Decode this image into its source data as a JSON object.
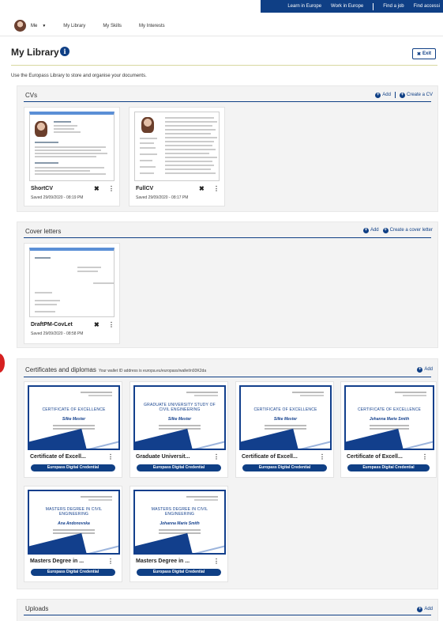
{
  "topbar": {
    "links": [
      "Learn in Europe",
      "Work in Europe",
      "Find a job",
      "Find accessi"
    ]
  },
  "subnav": {
    "me_label": "Me",
    "links": [
      "My Library",
      "My Skills",
      "My Interests"
    ]
  },
  "header": {
    "title": "My Library",
    "exit_label": "Exit"
  },
  "intro": "Use the Europass Library to store and organise your documents.",
  "cvs": {
    "title": "CVs",
    "add_label": "Add",
    "create_label": "Create a CV",
    "items": [
      {
        "name": "ShortCV",
        "saved": "Saved 29/09/2020 - 08:19 PM"
      },
      {
        "name": "FullCV",
        "saved": "Saved 29/09/2020 - 08:17 PM"
      }
    ]
  },
  "cover_letters": {
    "title": "Cover letters",
    "add_label": "Add",
    "create_label": "Create a cover letter",
    "items": [
      {
        "name": "DraftPM-CovLet",
        "saved": "Saved 29/09/2020 - 08:58 PM"
      }
    ]
  },
  "certificates": {
    "title": "Certificates and diplomas",
    "note": "Your wallet ID address is europa.eu/europass/wallet/n93K2da",
    "add_label": "Add",
    "badge_label": "Europass Digital Credential",
    "items": [
      {
        "name": "Certificate of Excell...",
        "cert_title": "CERTIFICATE OF EXCELLENCE",
        "holder": "Silke Mester"
      },
      {
        "name": "Graduate Universit...",
        "cert_title": "GRADUATE UNIVERSITY STUDY OF CIVIL ENGINEERING",
        "holder": "Silke Mester"
      },
      {
        "name": "Certificate of Excell...",
        "cert_title": "CERTIFICATE OF EXCELLENCE",
        "holder": "Silke Mester"
      },
      {
        "name": "Certificate of Excell...",
        "cert_title": "CERTIFICATE OF EXCELLENCE",
        "holder": "Johanna Marie Smith"
      },
      {
        "name": "Masters Degree in ...",
        "cert_title": "MASTERS DEGREE IN CIVIL ENGINEERING",
        "holder": "Ana Andonovska"
      },
      {
        "name": "Masters Degree in ...",
        "cert_title": "MASTERS DEGREE IN CIVIL ENGINEERING",
        "holder": "Johanna Marie Smith"
      }
    ]
  },
  "uploads": {
    "title": "Uploads",
    "add_label": "Add"
  },
  "colors": {
    "brand_blue": "#0f3f85",
    "alert_red": "#d62020"
  }
}
